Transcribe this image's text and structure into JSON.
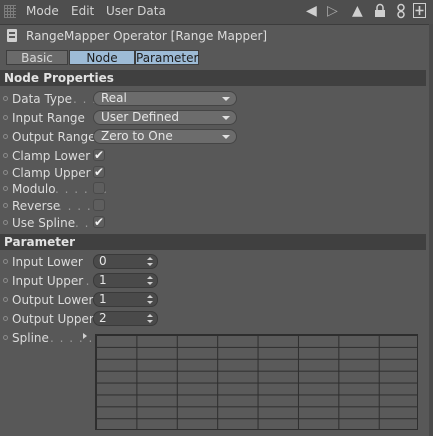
{
  "menubar": {
    "items": [
      "Mode",
      "Edit",
      "User Data"
    ],
    "icons": [
      "back-arrow-icon",
      "forward-arrow-icon",
      "up-arrow-icon",
      "lock-icon",
      "link-icon",
      "add-icon"
    ]
  },
  "title": {
    "text": "RangeMapper Operator [Range Mapper]"
  },
  "tabs": [
    {
      "label": "Basic",
      "active": false
    },
    {
      "label": "Node",
      "active": true
    },
    {
      "label": "Parameter",
      "active": true
    }
  ],
  "node_properties": {
    "header": "Node Properties",
    "data_type": {
      "label": "Data Type",
      "dots": " . . .",
      "value": "Real"
    },
    "input_range": {
      "label": "Input Range",
      "value": "User Defined"
    },
    "output_range": {
      "label": "Output Range",
      "value": "Zero to One"
    },
    "clamp_lower": {
      "label": "Clamp Lower",
      "checked": true,
      "mark": "✔"
    },
    "clamp_upper": {
      "label": "Clamp Upper",
      "checked": true,
      "mark": "✔"
    },
    "modulo": {
      "label": "Modulo",
      "dots": ". . . . . .",
      "checked": false,
      "mark": ""
    },
    "reverse": {
      "label": "Reverse",
      "dots": " . . . . .",
      "checked": false,
      "mark": ""
    },
    "use_spline": {
      "label": "Use Spline",
      "dots": " . .",
      "checked": true,
      "mark": "✔"
    }
  },
  "parameter": {
    "header": "Parameter",
    "input_lower": {
      "label": "Input Lower",
      "value": "0"
    },
    "input_upper": {
      "label": "Input Upper",
      "dots": " . .",
      "value": "1"
    },
    "output_lower": {
      "label": "Output Lower",
      "value": "1"
    },
    "output_upper": {
      "label": "Output Upper",
      "value": "2"
    },
    "spline": {
      "label": "Spline",
      "dots": " . . . . ."
    }
  },
  "colors": {
    "background": "#585858",
    "active_tab": "#9dbbd6",
    "section_header": "#404040"
  }
}
